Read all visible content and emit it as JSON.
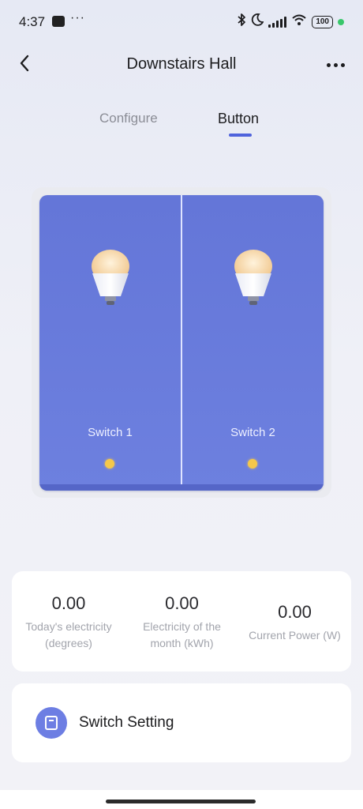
{
  "status_bar": {
    "time": "4:37",
    "dots": "···",
    "battery": "100",
    "icons": [
      "bluetooth-icon",
      "moon-icon",
      "signal-icon",
      "wifi-icon",
      "battery-icon"
    ]
  },
  "header": {
    "title": "Downstairs Hall",
    "back_icon": "chevron-left-icon",
    "more_icon": "more-horizontal-icon"
  },
  "tabs": [
    {
      "label": "Configure",
      "active": false
    },
    {
      "label": "Button",
      "active": true
    }
  ],
  "switch_panel": {
    "gangs": [
      {
        "label": "Switch 1",
        "icon": "light-bulb-icon",
        "indicator_color": "#f5c84a"
      },
      {
        "label": "Switch 2",
        "icon": "light-bulb-icon",
        "indicator_color": "#f5c84a"
      }
    ],
    "panel_color": "#6a7bdc"
  },
  "stats": [
    {
      "value": "0.00",
      "label": "Today's electricity\n(degrees)"
    },
    {
      "value": "0.00",
      "label": "Electricity of the\nmonth (kWh)"
    },
    {
      "value": "0.00",
      "label": "Current Power (W)"
    }
  ],
  "settings": {
    "switch_setting_label": "Switch Setting",
    "icon": "switch-panel-icon"
  },
  "colors": {
    "accent": "#4f63dc",
    "indicator": "#f5c84a"
  }
}
